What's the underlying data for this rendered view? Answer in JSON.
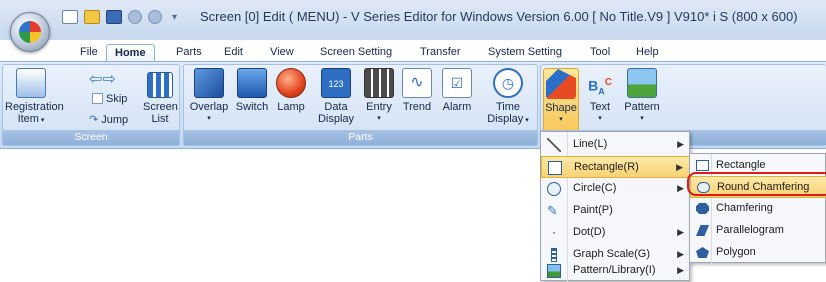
{
  "window": {
    "title": "Screen [0] Edit (        MENU) - V Series Editor for Windows Version 6.00 [ No Title.V9 ] V910* i S (800 x 600)"
  },
  "tabs": [
    "File",
    "Home",
    "Parts",
    "Edit",
    "View",
    "Screen Setting",
    "Transfer",
    "System Setting",
    "Tool",
    "Help"
  ],
  "active_tab": "Home",
  "ribbon": {
    "screen_group": {
      "label": "Screen",
      "registration": "Registration",
      "registration2": "Item",
      "skip": "Skip",
      "jump": "Jump",
      "screen_list": "Screen",
      "screen_list2": "List"
    },
    "parts_group": {
      "label": "Parts",
      "items": [
        "Overlap",
        "Switch",
        "Lamp",
        "Data",
        "Entry",
        "Trend",
        "Alarm",
        "Time"
      ],
      "data2": "Display",
      "time2": "Display"
    },
    "draw_group": {
      "items": [
        "Shape",
        "Text",
        "Pattern"
      ]
    }
  },
  "shape_menu": [
    {
      "label": "Line(L)",
      "icon": "line-icon",
      "has_sub": true
    },
    {
      "label": "Rectangle(R)",
      "icon": "rectangle-icon",
      "has_sub": true,
      "highlighted": true
    },
    {
      "label": "Circle(C)",
      "icon": "circle-icon",
      "has_sub": true
    },
    {
      "label": "Paint(P)",
      "icon": "paint-icon",
      "has_sub": false
    },
    {
      "label": "Dot(D)",
      "icon": "dot-icon",
      "has_sub": true
    },
    {
      "label": "Graph Scale(G)",
      "icon": "graph-scale-icon",
      "has_sub": true
    },
    {
      "label": "Pattern/Library(I)",
      "icon": "pattern-library-icon",
      "has_sub": true
    }
  ],
  "rectangle_submenu": [
    {
      "label": "Rectangle",
      "icon": "rectangle-icon"
    },
    {
      "label": "Round Chamfering",
      "icon": "round-chamfering-icon",
      "highlighted": true
    },
    {
      "label": "Chamfering",
      "icon": "chamfering-icon"
    },
    {
      "label": "Parallelogram",
      "icon": "parallelogram-icon"
    },
    {
      "label": "Polygon",
      "icon": "polygon-icon"
    }
  ],
  "colors": {
    "ribbon": "#dae7f6",
    "highlight": "#f9d374",
    "callout": "#e01a1a"
  }
}
